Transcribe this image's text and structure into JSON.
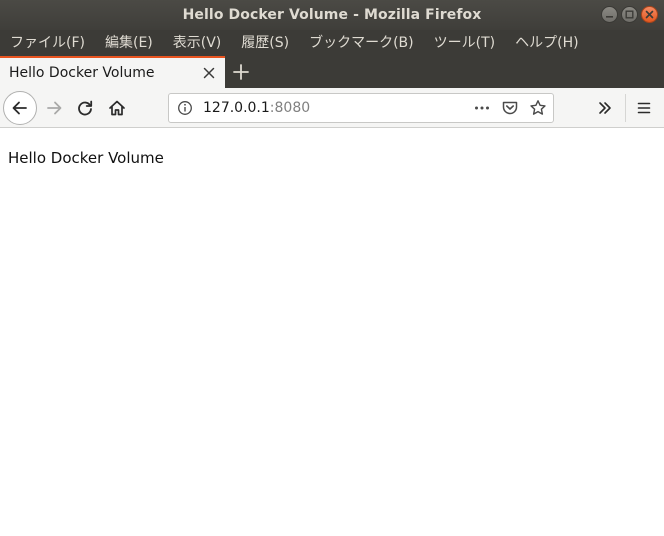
{
  "window": {
    "title": "Hello Docker Volume - Mozilla Firefox"
  },
  "menubar": {
    "items": [
      {
        "label": "ファイル(F)"
      },
      {
        "label": "編集(E)"
      },
      {
        "label": "表示(V)"
      },
      {
        "label": "履歴(S)"
      },
      {
        "label": "ブックマーク(B)"
      },
      {
        "label": "ツール(T)"
      },
      {
        "label": "ヘルプ(H)"
      }
    ]
  },
  "tabs": [
    {
      "label": "Hello Docker Volume",
      "active": true
    }
  ],
  "navbar": {
    "url_host": "127.0.0.1",
    "url_port": ":8080"
  },
  "content": {
    "text": "Hello Docker Volume"
  },
  "icons": {
    "wm_minimize": "minimize-icon",
    "wm_maximize": "maximize-icon",
    "wm_close": "close-icon",
    "tab_close": "close-icon",
    "new_tab": "plus-icon",
    "back": "arrow-left-icon",
    "forward": "arrow-right-icon",
    "reload": "reload-icon",
    "home": "home-icon",
    "site_info": "info-icon",
    "page_actions": "ellipsis-icon",
    "pocket": "pocket-icon",
    "bookmark": "star-icon",
    "overflow": "chevron-double-right-icon",
    "app_menu": "hamburger-icon"
  },
  "colors": {
    "accent": "#e95420",
    "titlebar": "#3c3b37",
    "toolbar": "#f5f5f4"
  }
}
